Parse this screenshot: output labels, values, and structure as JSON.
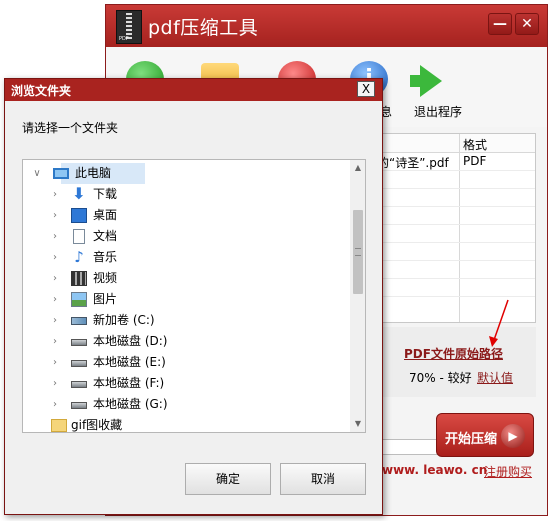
{
  "app": {
    "title": "pdf压缩工具",
    "logo_tag": "PDF",
    "min_glyph": "—",
    "close_glyph": "✕",
    "toolbar": {
      "info_label": "息",
      "exit_label": "退出程序"
    },
    "file_list": {
      "column_format": "格式",
      "rows": [
        {
          "name": "杜甫的“诗圣”.pdf",
          "visible_name": "甫的“诗圣”.pdf",
          "format": "PDF"
        }
      ]
    },
    "settings": {
      "path_link": "PDF文件原始路径",
      "quality": "70% - 较好",
      "default_link": "默认值"
    },
    "start_button": "开始压缩",
    "footer_url": "www. leawo. cn",
    "footer_register": "注册购买",
    "annotation_color": "#e00000"
  },
  "dialog": {
    "title": "浏览文件夹",
    "close_glyph": "X",
    "prompt": "请选择一个文件夹",
    "tree": [
      {
        "label": "此电脑",
        "icon": "computer-icon",
        "expanded": true,
        "selected": true
      },
      {
        "label": "下载",
        "icon": "download-icon"
      },
      {
        "label": "桌面",
        "icon": "desktop-icon"
      },
      {
        "label": "文档",
        "icon": "document-icon"
      },
      {
        "label": "音乐",
        "icon": "music-icon"
      },
      {
        "label": "视频",
        "icon": "video-icon"
      },
      {
        "label": "图片",
        "icon": "picture-icon"
      },
      {
        "label": "新加卷 (C:)",
        "icon": "network-drive-icon"
      },
      {
        "label": "本地磁盘 (D:)",
        "icon": "disk-icon"
      },
      {
        "label": "本地磁盘 (E:)",
        "icon": "disk-icon"
      },
      {
        "label": "本地磁盘 (F:)",
        "icon": "disk-icon"
      },
      {
        "label": "本地磁盘 (G:)",
        "icon": "disk-icon"
      },
      {
        "label": "gif图收藏",
        "icon": "folder-icon"
      }
    ],
    "ok": "确定",
    "cancel": "取消"
  }
}
